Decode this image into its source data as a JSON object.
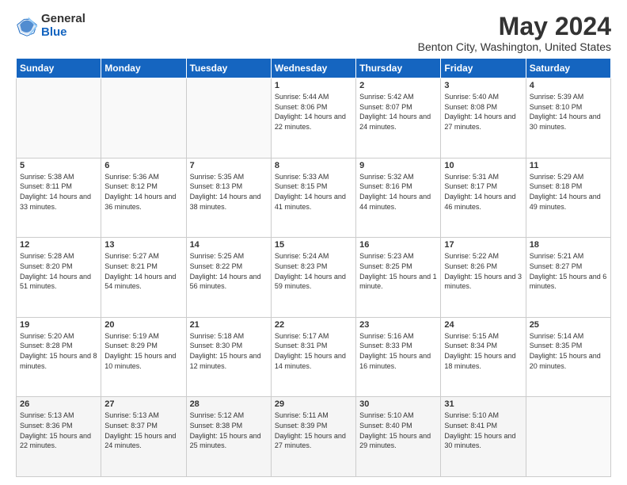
{
  "header": {
    "logo_general": "General",
    "logo_blue": "Blue",
    "title": "May 2024",
    "location": "Benton City, Washington, United States"
  },
  "days_of_week": [
    "Sunday",
    "Monday",
    "Tuesday",
    "Wednesday",
    "Thursday",
    "Friday",
    "Saturday"
  ],
  "weeks": [
    [
      {
        "day": "",
        "sunrise": "",
        "sunset": "",
        "daylight": ""
      },
      {
        "day": "",
        "sunrise": "",
        "sunset": "",
        "daylight": ""
      },
      {
        "day": "",
        "sunrise": "",
        "sunset": "",
        "daylight": ""
      },
      {
        "day": "1",
        "sunrise": "Sunrise: 5:44 AM",
        "sunset": "Sunset: 8:06 PM",
        "daylight": "Daylight: 14 hours and 22 minutes."
      },
      {
        "day": "2",
        "sunrise": "Sunrise: 5:42 AM",
        "sunset": "Sunset: 8:07 PM",
        "daylight": "Daylight: 14 hours and 24 minutes."
      },
      {
        "day": "3",
        "sunrise": "Sunrise: 5:40 AM",
        "sunset": "Sunset: 8:08 PM",
        "daylight": "Daylight: 14 hours and 27 minutes."
      },
      {
        "day": "4",
        "sunrise": "Sunrise: 5:39 AM",
        "sunset": "Sunset: 8:10 PM",
        "daylight": "Daylight: 14 hours and 30 minutes."
      }
    ],
    [
      {
        "day": "5",
        "sunrise": "Sunrise: 5:38 AM",
        "sunset": "Sunset: 8:11 PM",
        "daylight": "Daylight: 14 hours and 33 minutes."
      },
      {
        "day": "6",
        "sunrise": "Sunrise: 5:36 AM",
        "sunset": "Sunset: 8:12 PM",
        "daylight": "Daylight: 14 hours and 36 minutes."
      },
      {
        "day": "7",
        "sunrise": "Sunrise: 5:35 AM",
        "sunset": "Sunset: 8:13 PM",
        "daylight": "Daylight: 14 hours and 38 minutes."
      },
      {
        "day": "8",
        "sunrise": "Sunrise: 5:33 AM",
        "sunset": "Sunset: 8:15 PM",
        "daylight": "Daylight: 14 hours and 41 minutes."
      },
      {
        "day": "9",
        "sunrise": "Sunrise: 5:32 AM",
        "sunset": "Sunset: 8:16 PM",
        "daylight": "Daylight: 14 hours and 44 minutes."
      },
      {
        "day": "10",
        "sunrise": "Sunrise: 5:31 AM",
        "sunset": "Sunset: 8:17 PM",
        "daylight": "Daylight: 14 hours and 46 minutes."
      },
      {
        "day": "11",
        "sunrise": "Sunrise: 5:29 AM",
        "sunset": "Sunset: 8:18 PM",
        "daylight": "Daylight: 14 hours and 49 minutes."
      }
    ],
    [
      {
        "day": "12",
        "sunrise": "Sunrise: 5:28 AM",
        "sunset": "Sunset: 8:20 PM",
        "daylight": "Daylight: 14 hours and 51 minutes."
      },
      {
        "day": "13",
        "sunrise": "Sunrise: 5:27 AM",
        "sunset": "Sunset: 8:21 PM",
        "daylight": "Daylight: 14 hours and 54 minutes."
      },
      {
        "day": "14",
        "sunrise": "Sunrise: 5:25 AM",
        "sunset": "Sunset: 8:22 PM",
        "daylight": "Daylight: 14 hours and 56 minutes."
      },
      {
        "day": "15",
        "sunrise": "Sunrise: 5:24 AM",
        "sunset": "Sunset: 8:23 PM",
        "daylight": "Daylight: 14 hours and 59 minutes."
      },
      {
        "day": "16",
        "sunrise": "Sunrise: 5:23 AM",
        "sunset": "Sunset: 8:25 PM",
        "daylight": "Daylight: 15 hours and 1 minute."
      },
      {
        "day": "17",
        "sunrise": "Sunrise: 5:22 AM",
        "sunset": "Sunset: 8:26 PM",
        "daylight": "Daylight: 15 hours and 3 minutes."
      },
      {
        "day": "18",
        "sunrise": "Sunrise: 5:21 AM",
        "sunset": "Sunset: 8:27 PM",
        "daylight": "Daylight: 15 hours and 6 minutes."
      }
    ],
    [
      {
        "day": "19",
        "sunrise": "Sunrise: 5:20 AM",
        "sunset": "Sunset: 8:28 PM",
        "daylight": "Daylight: 15 hours and 8 minutes."
      },
      {
        "day": "20",
        "sunrise": "Sunrise: 5:19 AM",
        "sunset": "Sunset: 8:29 PM",
        "daylight": "Daylight: 15 hours and 10 minutes."
      },
      {
        "day": "21",
        "sunrise": "Sunrise: 5:18 AM",
        "sunset": "Sunset: 8:30 PM",
        "daylight": "Daylight: 15 hours and 12 minutes."
      },
      {
        "day": "22",
        "sunrise": "Sunrise: 5:17 AM",
        "sunset": "Sunset: 8:31 PM",
        "daylight": "Daylight: 15 hours and 14 minutes."
      },
      {
        "day": "23",
        "sunrise": "Sunrise: 5:16 AM",
        "sunset": "Sunset: 8:33 PM",
        "daylight": "Daylight: 15 hours and 16 minutes."
      },
      {
        "day": "24",
        "sunrise": "Sunrise: 5:15 AM",
        "sunset": "Sunset: 8:34 PM",
        "daylight": "Daylight: 15 hours and 18 minutes."
      },
      {
        "day": "25",
        "sunrise": "Sunrise: 5:14 AM",
        "sunset": "Sunset: 8:35 PM",
        "daylight": "Daylight: 15 hours and 20 minutes."
      }
    ],
    [
      {
        "day": "26",
        "sunrise": "Sunrise: 5:13 AM",
        "sunset": "Sunset: 8:36 PM",
        "daylight": "Daylight: 15 hours and 22 minutes."
      },
      {
        "day": "27",
        "sunrise": "Sunrise: 5:13 AM",
        "sunset": "Sunset: 8:37 PM",
        "daylight": "Daylight: 15 hours and 24 minutes."
      },
      {
        "day": "28",
        "sunrise": "Sunrise: 5:12 AM",
        "sunset": "Sunset: 8:38 PM",
        "daylight": "Daylight: 15 hours and 25 minutes."
      },
      {
        "day": "29",
        "sunrise": "Sunrise: 5:11 AM",
        "sunset": "Sunset: 8:39 PM",
        "daylight": "Daylight: 15 hours and 27 minutes."
      },
      {
        "day": "30",
        "sunrise": "Sunrise: 5:10 AM",
        "sunset": "Sunset: 8:40 PM",
        "daylight": "Daylight: 15 hours and 29 minutes."
      },
      {
        "day": "31",
        "sunrise": "Sunrise: 5:10 AM",
        "sunset": "Sunset: 8:41 PM",
        "daylight": "Daylight: 15 hours and 30 minutes."
      },
      {
        "day": "",
        "sunrise": "",
        "sunset": "",
        "daylight": ""
      }
    ]
  ]
}
